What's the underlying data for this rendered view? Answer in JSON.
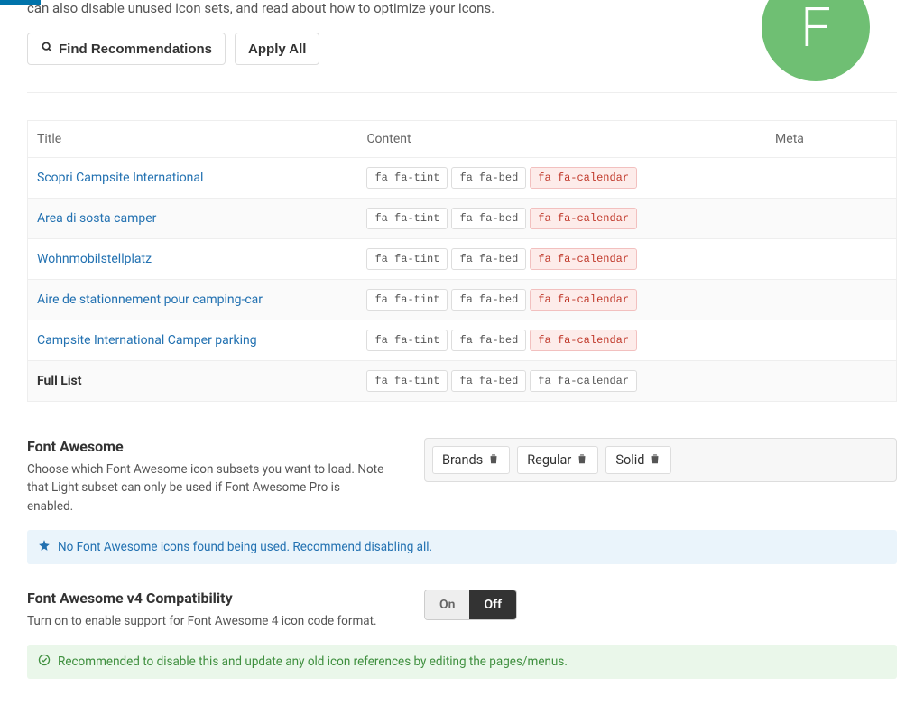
{
  "intro_tail": "can also disable unused icon sets, and read about how to optimize your icons.",
  "buttons": {
    "find": "Find Recommendations",
    "apply_all": "Apply All"
  },
  "big_badge": "F",
  "table": {
    "headers": {
      "title": "Title",
      "content": "Content",
      "meta": "Meta"
    },
    "rows": [
      {
        "title": "Scopri Campsite International",
        "link": true,
        "tags": [
          {
            "text": "fa fa-tint",
            "bad": false
          },
          {
            "text": "fa fa-bed",
            "bad": false
          },
          {
            "text": "fa fa-calendar",
            "bad": true
          }
        ]
      },
      {
        "title": "Area di sosta camper",
        "link": true,
        "tags": [
          {
            "text": "fa fa-tint",
            "bad": false
          },
          {
            "text": "fa fa-bed",
            "bad": false
          },
          {
            "text": "fa fa-calendar",
            "bad": true
          }
        ]
      },
      {
        "title": "Wohnmobilstellplatz",
        "link": true,
        "tags": [
          {
            "text": "fa fa-tint",
            "bad": false
          },
          {
            "text": "fa fa-bed",
            "bad": false
          },
          {
            "text": "fa fa-calendar",
            "bad": true
          }
        ]
      },
      {
        "title": "Aire de stationnement pour camping-car",
        "link": true,
        "tags": [
          {
            "text": "fa fa-tint",
            "bad": false
          },
          {
            "text": "fa fa-bed",
            "bad": false
          },
          {
            "text": "fa fa-calendar",
            "bad": true
          }
        ]
      },
      {
        "title": "Campsite International Camper parking",
        "link": true,
        "tags": [
          {
            "text": "fa fa-tint",
            "bad": false
          },
          {
            "text": "fa fa-bed",
            "bad": false
          },
          {
            "text": "fa fa-calendar",
            "bad": true
          }
        ]
      },
      {
        "title": "Full List",
        "link": false,
        "tags": [
          {
            "text": "fa fa-tint",
            "bad": false
          },
          {
            "text": "fa fa-bed",
            "bad": false
          },
          {
            "text": "fa fa-calendar",
            "bad": false
          }
        ]
      }
    ]
  },
  "fa_section": {
    "title": "Font Awesome",
    "desc": "Choose which Font Awesome icon subsets you want to load. Note that Light subset can only be used if Font Awesome Pro is enabled.",
    "chips": [
      "Brands",
      "Regular",
      "Solid"
    ],
    "notice": "No Font Awesome icons found being used. Recommend disabling all."
  },
  "fa4_section": {
    "title": "Font Awesome v4 Compatibility",
    "desc": "Turn on to enable support for Font Awesome 4 icon code format.",
    "toggle": {
      "on": "On",
      "off": "Off"
    },
    "notice": "Recommended to disable this and update any old icon references by editing the pages/menus."
  }
}
